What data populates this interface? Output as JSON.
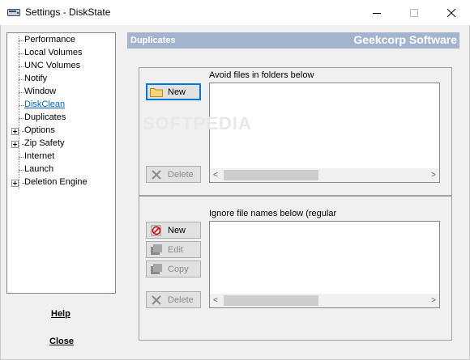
{
  "window": {
    "title": "Settings - DiskState"
  },
  "tree": {
    "items": [
      {
        "label": "Performance",
        "expandable": false,
        "link": false
      },
      {
        "label": "Local Volumes",
        "expandable": false,
        "link": false
      },
      {
        "label": "UNC Volumes",
        "expandable": false,
        "link": false
      },
      {
        "label": "Notify",
        "expandable": false,
        "link": false
      },
      {
        "label": "Window",
        "expandable": false,
        "link": false
      },
      {
        "label": "DiskClean",
        "expandable": false,
        "link": true
      },
      {
        "label": "Duplicates",
        "expandable": false,
        "link": false
      },
      {
        "label": "Options",
        "expandable": true,
        "link": false
      },
      {
        "label": "Zip Safety",
        "expandable": true,
        "link": false
      },
      {
        "label": "Internet",
        "expandable": false,
        "link": false
      },
      {
        "label": "Launch",
        "expandable": false,
        "link": false
      },
      {
        "label": "Deletion Engine",
        "expandable": true,
        "link": false
      }
    ]
  },
  "footer": {
    "help_label": "Help",
    "close_label": "Close"
  },
  "header": {
    "section": "Duplicates",
    "brand": "Geekcorp Software"
  },
  "folders_panel": {
    "caption": "Avoid files in folders below",
    "new_label": "New",
    "delete_label": "Delete"
  },
  "names_panel": {
    "caption": "Ignore file names below (regular",
    "new_label": "New",
    "edit_label": "Edit",
    "copy_label": "Copy",
    "delete_label": "Delete"
  },
  "watermark": "SOFTPEDIA"
}
